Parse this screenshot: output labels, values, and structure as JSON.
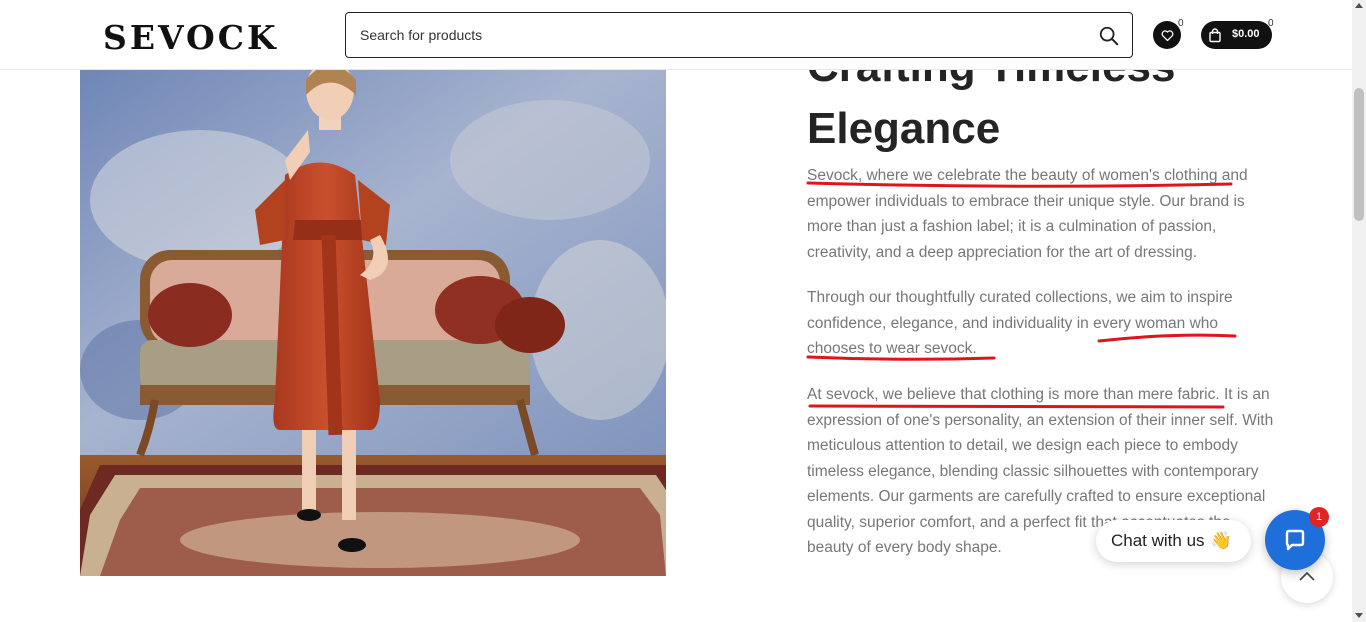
{
  "header": {
    "logo_text": "SEVOCK",
    "search_placeholder": "Search for products",
    "wishlist_count": "0",
    "cart_total": "$0.00",
    "cart_count": "0",
    "icons": [
      "search-icon",
      "heart-icon",
      "shopping-bag-icon"
    ]
  },
  "content": {
    "heading_line1": "Crafting Timeless",
    "heading_line2": "Elegance",
    "paragraph1": "Sevock, where we celebrate the beauty of women's clothing and empower individuals to embrace their unique style. Our brand is more than just a fashion label; it is a culmination of passion, creativity, and a deep appreciation for the art of dressing.",
    "paragraph2": "Through our thoughtfully curated collections, we aim to inspire confidence, elegance, and individuality in every woman who chooses to wear sevock.",
    "paragraph3": "At sevock, we believe that clothing is more than mere fabric. It is an expression of one's personality, an extension of their inner self. With meticulous attention to detail, we design each piece to embody timeless elegance, blending classic silhouettes with contemporary elements. Our garments are carefully crafted to ensure exceptional quality, superior comfort, and a perfect fit that accentuates the beauty of every body shape."
  },
  "annotation_color": "#e0141e",
  "chat": {
    "label": "Chat with us",
    "emoji": "👋",
    "badge": "1",
    "accent": "#1e6fd9"
  }
}
